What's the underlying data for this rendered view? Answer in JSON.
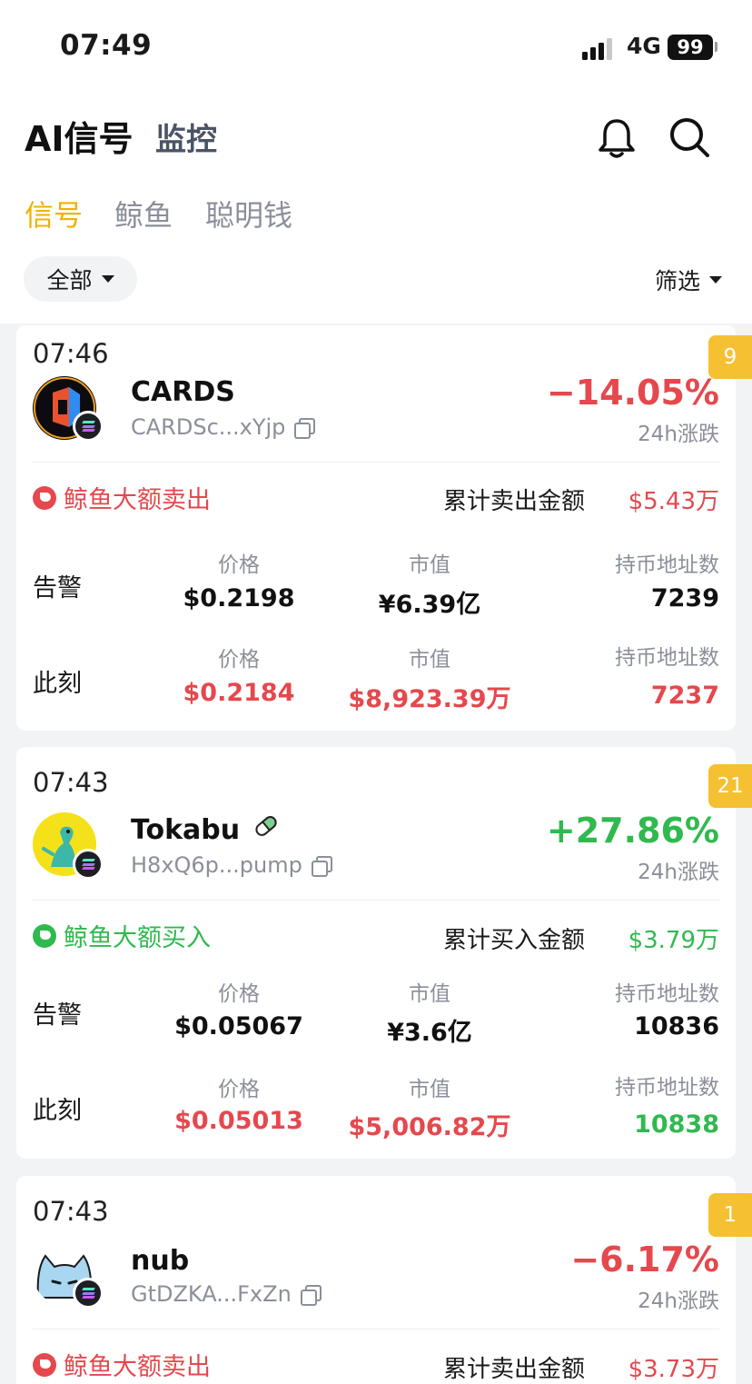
{
  "status_bar": {
    "time": "07:49",
    "network": "4G",
    "battery": "99"
  },
  "header": {
    "title": "AI信号",
    "secondary_tab": "监控"
  },
  "sub_tabs": [
    {
      "label": "信号",
      "active": true
    },
    {
      "label": "鲸鱼",
      "active": false
    },
    {
      "label": "聪明钱",
      "active": false
    }
  ],
  "filters": {
    "chip": "全部",
    "filter": "筛选"
  },
  "common": {
    "change_label": "24h涨跌",
    "alert_row": "告警",
    "now_row": "此刻",
    "price_head": "价格",
    "mcap_head": "市值",
    "holders_head": "持币地址数"
  },
  "colors": {
    "up": "#30b94f",
    "down": "#e5484d",
    "accent": "#f0b100",
    "badge": "#f5c032"
  },
  "cards": [
    {
      "time": "07:46",
      "badge": "9",
      "name": "CARDS",
      "address": "CARDSc...xYjp",
      "change": "−14.05%",
      "direction": "down",
      "action": "鲸鱼大额卖出",
      "sum_label": "累计卖出金额",
      "sum_value": "$5.43万",
      "alert": {
        "price": "$0.2198",
        "mcap": "¥6.39亿",
        "holders": "7239"
      },
      "now": {
        "price": "$0.2184",
        "mcap": "$8,923.39万",
        "holders": "7237"
      }
    },
    {
      "time": "07:43",
      "badge": "21",
      "name": "Tokabu",
      "address": "H8xQ6p...pump",
      "change": "+27.86%",
      "direction": "up",
      "action": "鲸鱼大额买入",
      "sum_label": "累计买入金额",
      "sum_value": "$3.79万",
      "alert": {
        "price": "$0.05067",
        "mcap": "¥3.6亿",
        "holders": "10836"
      },
      "now": {
        "price": "$0.05013",
        "mcap": "$5,006.82万",
        "holders": "10838"
      }
    },
    {
      "time": "07:43",
      "badge": "1",
      "name": "nub",
      "address": "GtDZKA...FxZn",
      "change": "−6.17%",
      "direction": "down",
      "action": "鲸鱼大额卖出",
      "sum_label": "累计卖出金额",
      "sum_value": "$3.73万"
    }
  ]
}
